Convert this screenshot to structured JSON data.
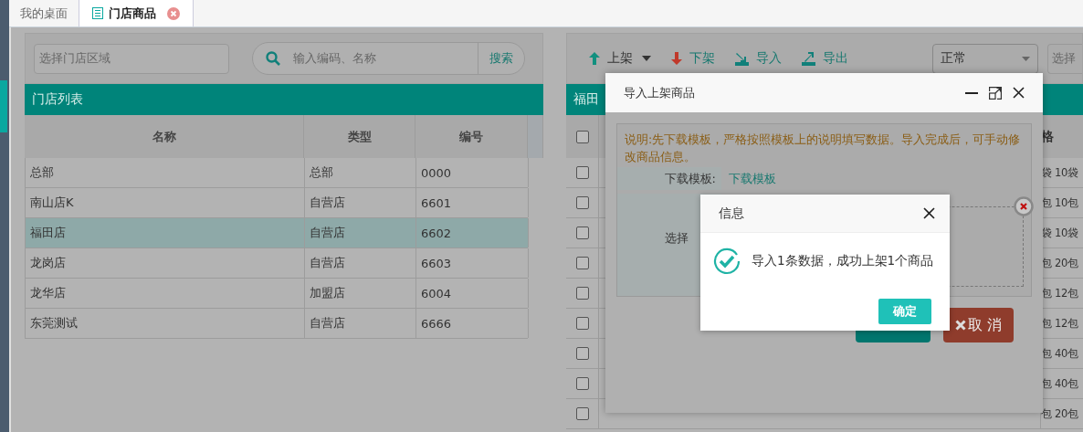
{
  "tabs": [
    {
      "label": "我的桌面",
      "selected": false
    },
    {
      "label": "门店商品",
      "selected": true
    }
  ],
  "store_panel": {
    "region_placeholder": "选择门店区域",
    "search_placeholder": "输入编码、名称",
    "search_button": "搜索",
    "title": "门店列表",
    "columns": [
      "名称",
      "类型",
      "编号"
    ],
    "rows": [
      {
        "cells": [
          "总部",
          "总部",
          "0000"
        ],
        "selected": false
      },
      {
        "cells": [
          "南山店K",
          "自营店",
          "6601"
        ],
        "selected": false
      },
      {
        "cells": [
          "福田店",
          "自营店",
          "6602"
        ],
        "selected": true
      },
      {
        "cells": [
          "龙岗店",
          "自营店",
          "6603"
        ],
        "selected": false
      },
      {
        "cells": [
          "龙华店",
          "加盟店",
          "6004"
        ],
        "selected": false
      },
      {
        "cells": [
          "东莞测试",
          "自营店",
          "6666"
        ],
        "selected": false
      }
    ]
  },
  "goods_panel": {
    "toolbar": [
      {
        "label": "上架",
        "kind": "up"
      },
      {
        "label": "下架",
        "kind": "down"
      },
      {
        "label": "导入",
        "kind": "import"
      },
      {
        "label": "导出",
        "kind": "export"
      }
    ],
    "status_select": "正常",
    "store_placeholder": "选择",
    "title": "福田",
    "header_checked": false,
    "last_column": "格",
    "rows": [
      {
        "checked": false,
        "last": "袋 10袋"
      },
      {
        "checked": false,
        "last": "包 10包"
      },
      {
        "checked": false,
        "last": "袋 10袋"
      },
      {
        "checked": false,
        "last": "包 20包"
      },
      {
        "checked": false,
        "last": "包 12包"
      },
      {
        "checked": false,
        "last": "包 12包"
      },
      {
        "checked": false,
        "last": "包 40包"
      },
      {
        "checked": false,
        "last": "包 40包"
      },
      {
        "checked": false,
        "last": "包 20包"
      }
    ]
  },
  "import_dialog": {
    "title": "导入上架商品",
    "note": "说明:先下载模板，严格按照模板上的说明填写数据。导入完成后，可手动修改商品信息。",
    "template_label": "下载模板:",
    "template_link": "下载模板",
    "file_label": "选择",
    "cancel_button": "取 消"
  },
  "info_dialog": {
    "title": "信息",
    "message": "导入1条数据，成功上架1个商品",
    "ok_button": "确定"
  }
}
